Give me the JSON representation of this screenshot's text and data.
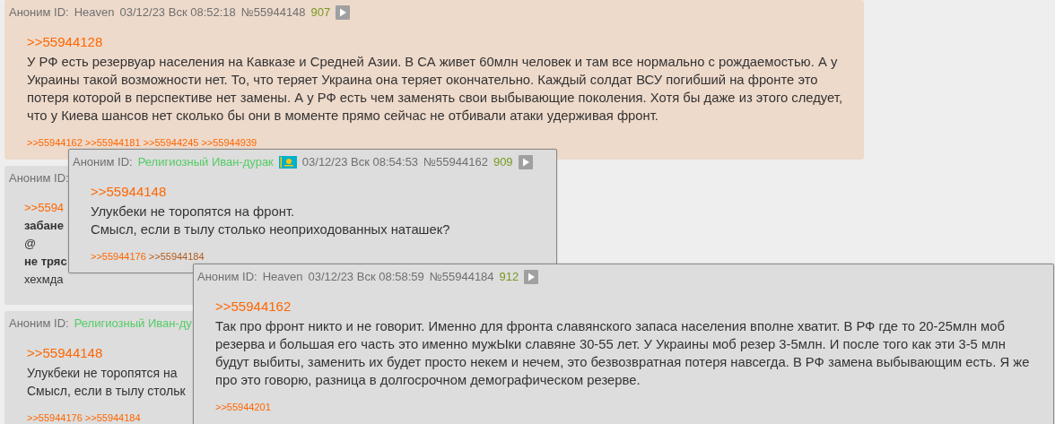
{
  "posts": [
    {
      "highlighted": true,
      "author": "Аноним ID:",
      "id": {
        "text": "Heaven",
        "color": "#6f6f6f"
      },
      "date": "03/12/23 Вск 08:52:18",
      "number": "№55944148",
      "count": "907",
      "reply_to": ">>55944128",
      "lines": [
        {
          "text": "У РФ есть резервуар населения на Кавказе и Средней Азии. В СА живет 60млн человек и там все нормально с рождаемостью. А у Украины такой возможности нет. То, что теряет Украина она теряет окончательно. Каждый солдат ВСУ погибший на фронте это потеря которой в перспективе нет замены. А у РФ есть чем заменять свои выбывающие поколения. Хотя бы даже из этого следует, что у Киева шансов нет сколько бы они в моменте прямо сейчас не отбивали атаки удерживая фронт.",
          "bold": false
        }
      ],
      "backlinks": [
        {
          "text": ">>55944162",
          "visited": false
        },
        {
          "text": ">>55944181",
          "visited": false
        },
        {
          "text": ">>55944245",
          "visited": false
        },
        {
          "text": ">>55944939",
          "visited": false
        }
      ]
    },
    {
      "highlighted": false,
      "author": "Аноним ID:",
      "reply_to": ">>5594",
      "lines": [
        {
          "text": "забане",
          "bold": true
        },
        {
          "text": "@",
          "bold": false
        },
        {
          "text": "не тряс",
          "bold": true
        },
        {
          "text": "хехмда",
          "bold": false
        }
      ]
    },
    {
      "highlighted": false,
      "author": "Аноним ID:",
      "id": {
        "text": "Религиозный Иван-ду",
        "color": "#55cc66"
      },
      "reply_to": ">>55944148",
      "lines": [
        {
          "text": "Улукбеки не торопятся на",
          "bold": false
        },
        {
          "text": "Смысл, если в тылу стольк",
          "bold": false
        }
      ],
      "backlinks": [
        {
          "text": ">>55944176",
          "visited": false
        },
        {
          "text": ">>55944184",
          "visited": false
        }
      ]
    }
  ],
  "popups": [
    {
      "highlighted": false,
      "author": "Аноним ID:",
      "id": {
        "text": "Религиозный Иван-дурак",
        "color": "#55cc66"
      },
      "has_flag": true,
      "date": "03/12/23 Вск 08:54:53",
      "number": "№55944162",
      "count": "909",
      "reply_to": ">>55944148",
      "lines": [
        {
          "text": "Улукбеки не торопятся на фронт.",
          "bold": false
        },
        {
          "text": "Смысл, если в тылу столько неоприходованных наташек?",
          "bold": false
        }
      ],
      "backlinks": [
        {
          "text": ">>55944176",
          "visited": false
        },
        {
          "text": ">>55944184",
          "visited": true
        }
      ]
    },
    {
      "highlighted": false,
      "author": "Аноним ID:",
      "id": {
        "text": "Heaven",
        "color": "#6f6f6f"
      },
      "date": "03/12/23 Вск 08:58:59",
      "number": "№55944184",
      "count": "912",
      "reply_to": ">>55944162",
      "lines": [
        {
          "text": "Так про фронт никто и не говорит. Именно для фронта славянского запаса населения вполне хватит. В РФ где то 20-25млн моб резерва и большая его часть это именно мужЫки славяне 30-55 лет. У Украины моб резер 3-5млн. И после того как эти 3-5 млн будут выбиты, заменить их будет просто некем и нечем, это безвозвратная потеря навсегда. В РФ замена выбывающим есть. Я же про это говорю, разница в долгосрочном демографическом резерве.",
          "bold": false
        }
      ],
      "backlinks": [
        {
          "text": ">>55944201",
          "visited": false
        }
      ]
    }
  ]
}
